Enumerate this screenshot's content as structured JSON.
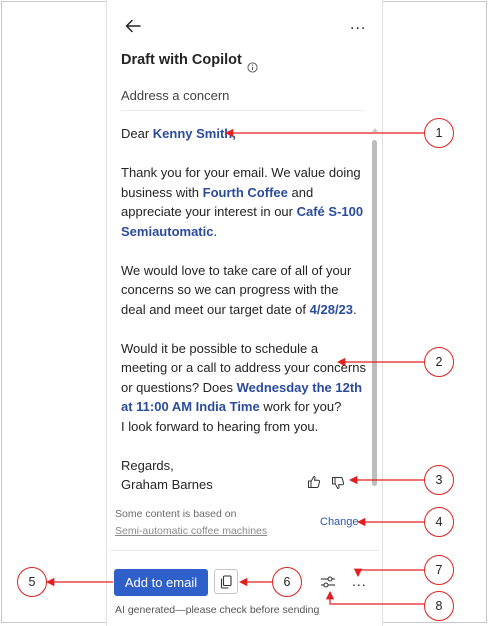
{
  "header": {
    "title": "Draft with Copilot",
    "subtitle": "Address a concern"
  },
  "email": {
    "greeting_prefix": "Dear ",
    "recipient": "Kenny Smith",
    "greeting_suffix": ",",
    "p1_a": "Thank you for your email. We value doing business with ",
    "company": "Fourth Coffee",
    "p1_b": " and appreciate your interest in our ",
    "product": "Café S-100 Semiautomatic",
    "p1_c": ".",
    "p2_a": "We would love to take care of all of your concerns so we can progress with the deal and meet our target date of ",
    "target_date": "4/28/23",
    "p2_b": ".",
    "p3_a": "Would it be possible to schedule a meeting or a call to address your concerns or questions? Does ",
    "meeting_time": "Wednesday the 12th at 11:00 AM India Time",
    "p3_b": " work for you?",
    "p3_c": "I look forward to hearing from you.",
    "closing": "Regards,",
    "signature": "Graham Barnes"
  },
  "source": {
    "label": "Some content is based on",
    "link": "Semi-automatic coffee machines",
    "change_label": "Change"
  },
  "footer": {
    "add_button": "Add to email",
    "more": "...",
    "disclaimer": "AI generated—please check before sending"
  },
  "top_more": "...",
  "icons": [
    "back-arrow-icon",
    "more-icon",
    "info-icon",
    "thumbs-up-icon",
    "thumbs-down-icon",
    "copy-icon",
    "tune-icon"
  ],
  "callouts": [
    "1",
    "2",
    "3",
    "4",
    "5",
    "6",
    "7",
    "8"
  ],
  "colors": {
    "accent": "#2f5fc8",
    "highlight": "#2b4c9c",
    "callout": "#e02020"
  }
}
